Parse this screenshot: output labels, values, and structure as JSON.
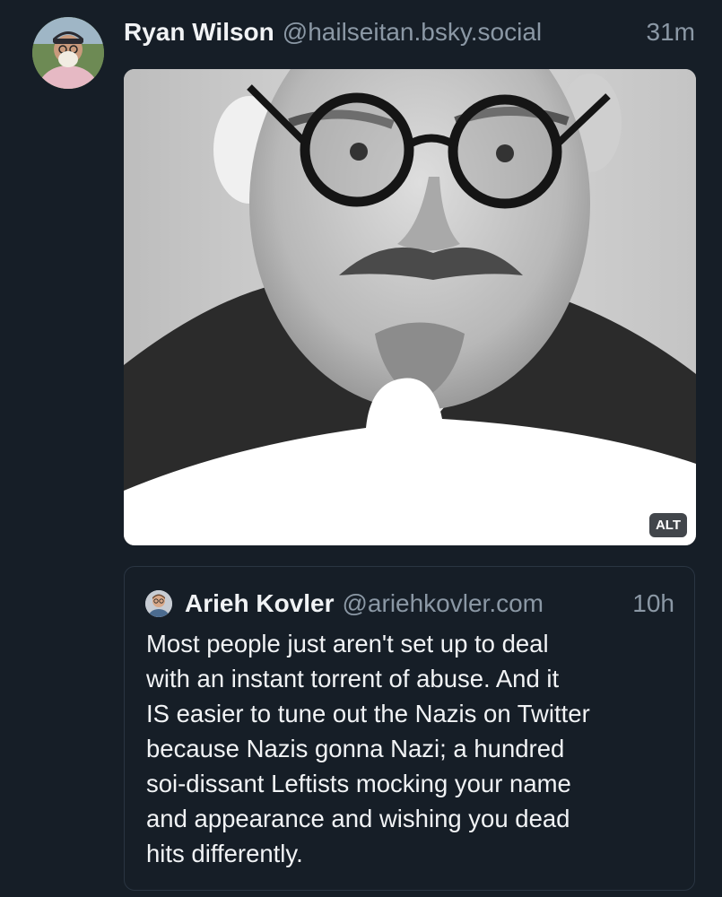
{
  "post": {
    "author_name": "Ryan Wilson",
    "author_handle": "@hailseitan.bsky.social",
    "time": "31m",
    "media": {
      "alt_badge": "ALT"
    }
  },
  "quote": {
    "author_name": "Arieh Kovler",
    "author_handle": "@ariehkovler.com",
    "time": "10h",
    "text": "Most people just aren't set up to deal\nwith an instant torrent of abuse. And it\nIS easier to tune out the Nazis on Twitter\nbecause Nazis gonna Nazi; a hundred\nsoi-dissant Leftists mocking your name\nand appearance and wishing you dead\nhits differently."
  },
  "colors": {
    "background": "#161e27",
    "text_primary": "#f1f3f5",
    "text_secondary": "#8b98a5",
    "border": "#2a3542"
  }
}
